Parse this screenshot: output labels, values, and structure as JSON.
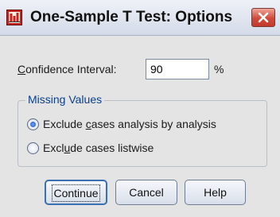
{
  "window": {
    "title": "One-Sample T Test: Options"
  },
  "confidence": {
    "label_prefix": "",
    "label_accesskey": "C",
    "label_rest": "onfidence Interval:",
    "value": "90",
    "unit": "%"
  },
  "missing_values": {
    "group_title": "Missing Values",
    "options": [
      {
        "pre": "Exclude ",
        "key": "c",
        "post": "ases analysis by analysis",
        "selected": true
      },
      {
        "pre": "Excl",
        "key": "u",
        "post": "de cases listwise",
        "selected": false
      }
    ]
  },
  "buttons": {
    "continue": "Continue",
    "cancel": "Cancel",
    "help": "Help"
  },
  "colors": {
    "group_title": "#0a3f8a",
    "close_button": "#cf4a3a",
    "default_button_border": "#3a6fb0"
  }
}
